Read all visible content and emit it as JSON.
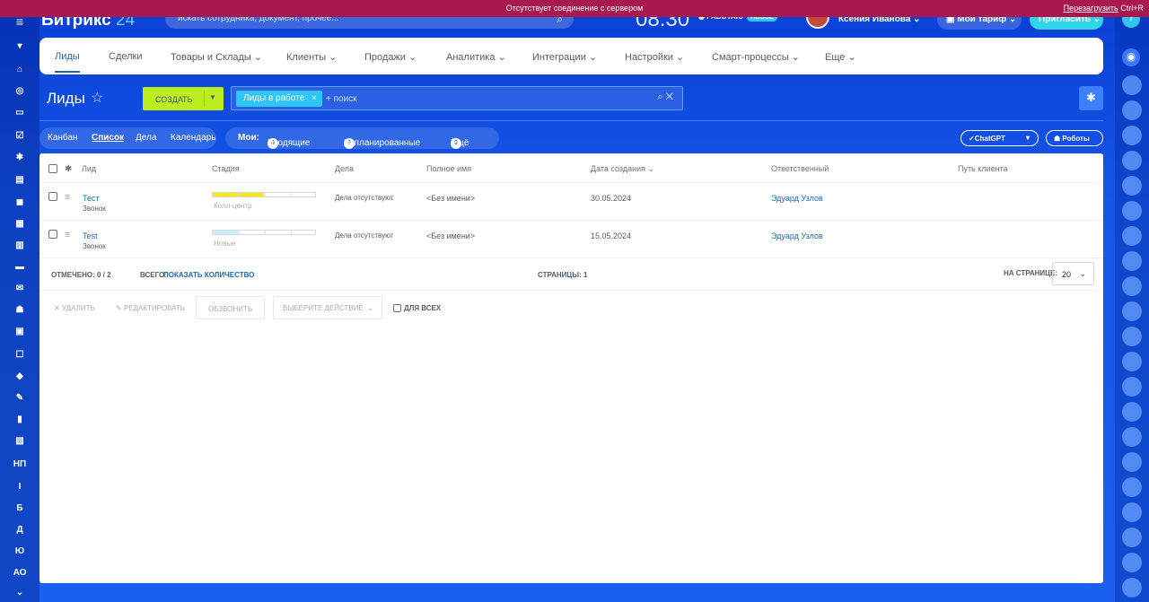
{
  "banner": {
    "message": "Отсутствует соединение с сервером",
    "reload": "Перезагрузить",
    "shortcut": "Ctrl+R"
  },
  "topbar": {
    "logo": "Битрикс",
    "logo_num": "24",
    "search_placeholder": "искать сотрудника, документ, прочее...",
    "clock": "08.30",
    "work_status": "РАБОТАЮ",
    "new_badge": "НОВОЕ",
    "user_name": "Ксения Иванова",
    "tarif": "Мой тариф",
    "invite": "Пригласить"
  },
  "menu": {
    "items": [
      "Лиды",
      "Сделки",
      "Товары и Склады",
      "Клиенты",
      "Продажи",
      "Аналитика",
      "Интеграции",
      "Настройки",
      "Смарт-процессы",
      "Еще"
    ]
  },
  "toolbar": {
    "title": "Лиды",
    "create_label": "СОЗДАТЬ",
    "filter_chip": "Лиды в работе",
    "filter_placeholder": "+ поиск"
  },
  "views": {
    "kanban": "Канбан",
    "list": "Список",
    "tasks": "Дела",
    "calendar": "Календарь"
  },
  "mine": {
    "label": "Мои:",
    "incoming_count": "0",
    "incoming": "Входящие",
    "planned_count": "0",
    "planned": "Запланированные",
    "more_count": "0",
    "more": "Ещё"
  },
  "ai": {
    "chatgpt": "✓ChatGPT",
    "robots": "Роботы"
  },
  "table": {
    "headers": [
      "Лид",
      "Стадия",
      "Дела",
      "Полное имя",
      "Дата создания",
      "Ответственный",
      "Путь клиента"
    ],
    "rows": [
      {
        "name": "Тест",
        "source": "Звонок",
        "stage": "Колл-центр",
        "stage_fill": 0.5,
        "stage_color": "#ffe600",
        "activity": "Дела отсутствуют",
        "full_name": "<Без имени>",
        "date": "30.05.2024",
        "owner": "Эдуард Узлов"
      },
      {
        "name": "Test",
        "source": "Звонок",
        "stage": "Новые",
        "stage_fill": 0.25,
        "stage_color": "#c6eefc",
        "activity": "Дела отсутствуют",
        "full_name": "<Без имени>",
        "date": "15.05.2024",
        "owner": "Эдуард Узлов"
      }
    ]
  },
  "footer": {
    "selected": "ОТМЕЧЕНО: 0 / 2",
    "total_label": "ВСЕГО:",
    "total_link": "ПОКАЗАТЬ КОЛИЧЕСТВО",
    "pages": "СТРАНИЦЫ: 1",
    "per_page_label": "НА СТРАНИЦЕ:",
    "per_page": "20"
  },
  "actions": {
    "delete": "УДАЛИТЬ",
    "edit": "РЕДАКТИРОВАТЬ",
    "call": "ОБЗВОНИТЬ",
    "choose": "ВЫБЕРИТЕ ДЕЙСТВИЕ",
    "for_all": "ДЛЯ ВСЕХ"
  },
  "leftbar": {
    "labels": [
      "НП",
      "І",
      "Б",
      "Д",
      "Ю",
      "АО"
    ]
  }
}
